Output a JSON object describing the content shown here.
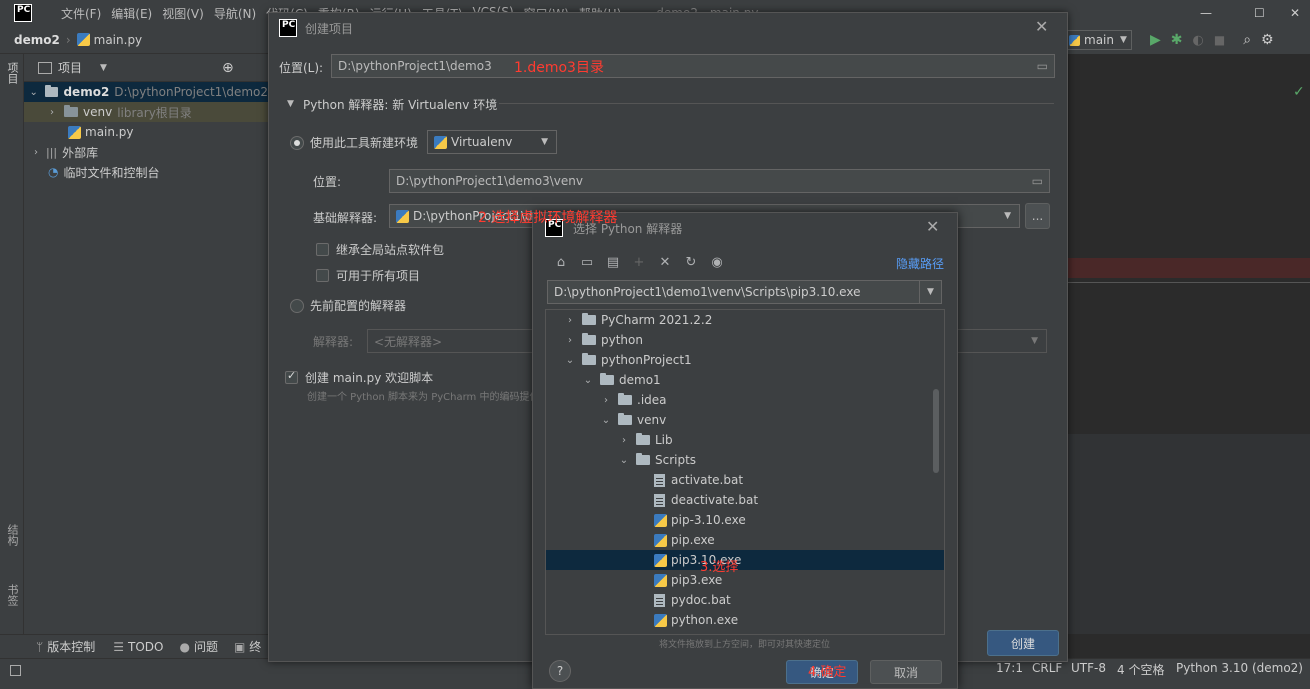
{
  "menubar": {
    "items": [
      "文件(F)",
      "编辑(E)",
      "视图(V)",
      "导航(N)",
      "代码(C)",
      "重构(R)",
      "运行(U)",
      "工具(T)",
      "VCS(S)",
      "窗口(W)",
      "帮助(H)"
    ],
    "title": "demo2 - main.py"
  },
  "navbar": {
    "project": "demo2",
    "file": "main.py"
  },
  "toolbar": {
    "run_config": "main"
  },
  "left_strip": {
    "project_tab": "项目",
    "structure_tab": "结构",
    "bookmarks_tab": "书签"
  },
  "project_panel": {
    "header": "项目",
    "tree": [
      {
        "name": "demo2",
        "path": "D:\\pythonProject1\\demo2"
      },
      {
        "name": "venv",
        "note": "library根目录"
      },
      {
        "name": "main.py"
      },
      {
        "name": "外部库"
      },
      {
        "name": "临时文件和控制台"
      }
    ]
  },
  "bottom_strip": {
    "items": [
      "版本控制",
      "TODO",
      "问题",
      "终"
    ]
  },
  "statusbar": {
    "position": "17:1",
    "line_sep": "CRLF",
    "encoding": "UTF-8",
    "indent": "4 个空格",
    "interpreter": "Python 3.10 (demo2)"
  },
  "create_dialog": {
    "title": "创建项目",
    "location_label": "位置(L):",
    "location_value": "D:\\pythonProject1\\demo3",
    "interpreter_section": "Python 解释器: 新 Virtualenv 环境",
    "new_env_label": "使用此工具新建环境",
    "env_tool": "Virtualenv",
    "venv_location_label": "位置:",
    "venv_location_value": "D:\\pythonProject1\\demo3\\venv",
    "base_interpreter_label": "基础解释器:",
    "base_interpreter_value": "D:\\pythonProject1\\de",
    "inherit_label": "继承全局站点软件包",
    "available_label": "可用于所有项目",
    "preconfigured_label": "先前配置的解释器",
    "interpreter_label": "解释器:",
    "interpreter_placeholder": "<无解释器>",
    "create_main_label": "创建 main.py 欢迎脚本",
    "create_main_desc": "创建一个 Python 脚本来为 PyCharm 中的编码提供",
    "create_button": "创建",
    "browse": "..."
  },
  "chooser_dialog": {
    "title": "选择 Python 解释器",
    "hide_path": "隐藏路径",
    "path_value": "D:\\pythonProject1\\demo1\\venv\\Scripts\\pip3.10.exe",
    "tree": [
      {
        "name": "PyCharm 2021.2.2",
        "kind": "folder",
        "level": 0,
        "open": false
      },
      {
        "name": "python",
        "kind": "folder",
        "level": 0,
        "open": false
      },
      {
        "name": "pythonProject1",
        "kind": "folder",
        "level": 0,
        "open": true
      },
      {
        "name": "demo1",
        "kind": "folder",
        "level": 1,
        "open": true
      },
      {
        "name": ".idea",
        "kind": "folder",
        "level": 2,
        "open": false
      },
      {
        "name": "venv",
        "kind": "folder",
        "level": 2,
        "open": true
      },
      {
        "name": "Lib",
        "kind": "folder",
        "level": 3,
        "open": false
      },
      {
        "name": "Scripts",
        "kind": "folder",
        "level": 3,
        "open": true
      },
      {
        "name": "activate.bat",
        "kind": "file",
        "level": 4
      },
      {
        "name": "deactivate.bat",
        "kind": "file",
        "level": 4
      },
      {
        "name": "pip-3.10.exe",
        "kind": "exe",
        "level": 4
      },
      {
        "name": "pip.exe",
        "kind": "exe",
        "level": 4
      },
      {
        "name": "pip3.10.exe",
        "kind": "exe",
        "level": 4,
        "selected": true
      },
      {
        "name": "pip3.exe",
        "kind": "exe",
        "level": 4
      },
      {
        "name": "pydoc.bat",
        "kind": "file",
        "level": 4
      },
      {
        "name": "python.exe",
        "kind": "exe",
        "level": 4
      }
    ],
    "drag_hint": "将文件拖放到上方空间，即可对其快速定位",
    "ok_button": "确定",
    "cancel_button": "取消",
    "help": "?"
  },
  "annotations": {
    "a1": "1.demo3目录",
    "a2": "2.选择虚拟环境解释器",
    "a3": "3.选择",
    "a4": "4.确定"
  },
  "colors": {
    "accent": "#365880",
    "selection": "#0d293e",
    "annotation": "#ff3b30"
  }
}
